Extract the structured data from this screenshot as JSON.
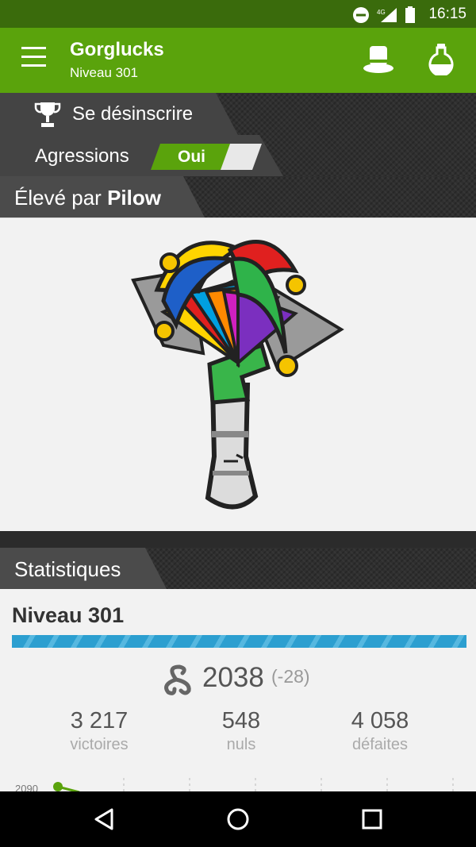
{
  "status_bar": {
    "time": "16:15",
    "network": "4G"
  },
  "app_bar": {
    "title": "Gorglucks",
    "subtitle": "Niveau 301"
  },
  "header": {
    "unsubscribe_label": "Se désinscrire",
    "aggressions_label": "Agressions",
    "aggressions_toggle": "Oui"
  },
  "pet_section": {
    "prefix": "Élevé par ",
    "owner": "Pilow"
  },
  "stats": {
    "section_title": "Statistiques",
    "level_title": "Niveau 301",
    "level_progress": 1.0,
    "rating": "2038",
    "rating_delta": "(-28)",
    "victories": {
      "value": "3 217",
      "label": "victoires"
    },
    "draws": {
      "value": "548",
      "label": "nuls"
    },
    "defeats": {
      "value": "4 058",
      "label": "défaites"
    },
    "chart_first_tick": "2090"
  },
  "colors": {
    "primary": "#5aa30c",
    "status_bar": "#3a6b0c",
    "progress": "#2aa0d0"
  },
  "icons": [
    "menu-icon",
    "top-hat-icon",
    "potion-flask-icon",
    "trophy-icon",
    "swirl-icon",
    "nav-back-icon",
    "nav-home-icon",
    "nav-recent-icon"
  ]
}
